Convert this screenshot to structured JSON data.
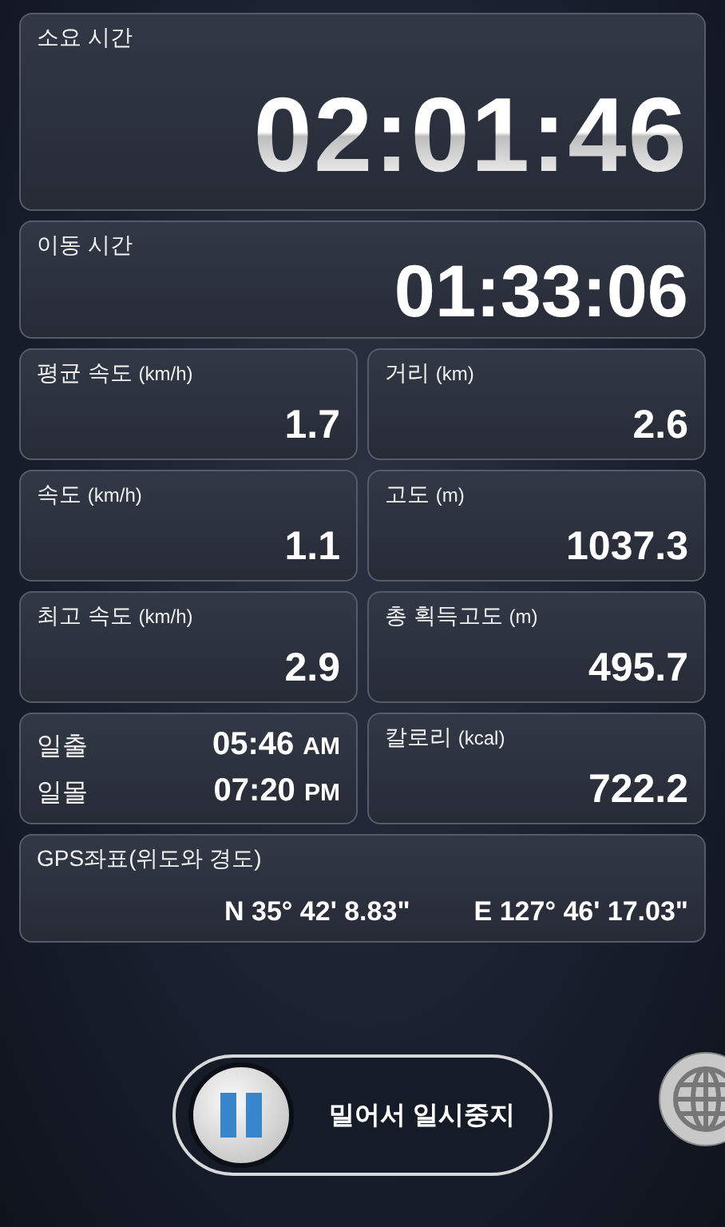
{
  "total_time": {
    "label": "소요 시간",
    "value": "02:01:46"
  },
  "moving_time": {
    "label": "이동 시간",
    "value": "01:33:06"
  },
  "stats": [
    {
      "kind": "stat",
      "label": "평균 속도",
      "unit": "(km/h)",
      "value": "1.7"
    },
    {
      "kind": "stat",
      "label": "거리",
      "unit": "(km)",
      "value": "2.6"
    },
    {
      "kind": "stat",
      "label": "속도",
      "unit": "(km/h)",
      "value": "1.1"
    },
    {
      "kind": "stat",
      "label": "고도",
      "unit": "(m)",
      "value": "1037.3"
    },
    {
      "kind": "stat",
      "label": "최고 속도",
      "unit": "(km/h)",
      "value": "2.9"
    },
    {
      "kind": "stat",
      "label": "총 획득고도",
      "unit": "(m)",
      "value": "495.7"
    },
    {
      "kind": "sun",
      "rows": [
        {
          "label": "일출",
          "time": "05:46",
          "ampm": "AM"
        },
        {
          "label": "일몰",
          "time": "07:20",
          "ampm": "PM"
        }
      ]
    },
    {
      "kind": "stat",
      "label": "칼로리",
      "unit": "(kcal)",
      "value": "722.2"
    }
  ],
  "gps": {
    "label": "GPS좌표(위도와 경도)",
    "latitude": "N 35° 42' 8.83\"",
    "longitude": "E 127° 46' 17.03\""
  },
  "pause_slider": {
    "label": "밀어서 일시중지"
  }
}
